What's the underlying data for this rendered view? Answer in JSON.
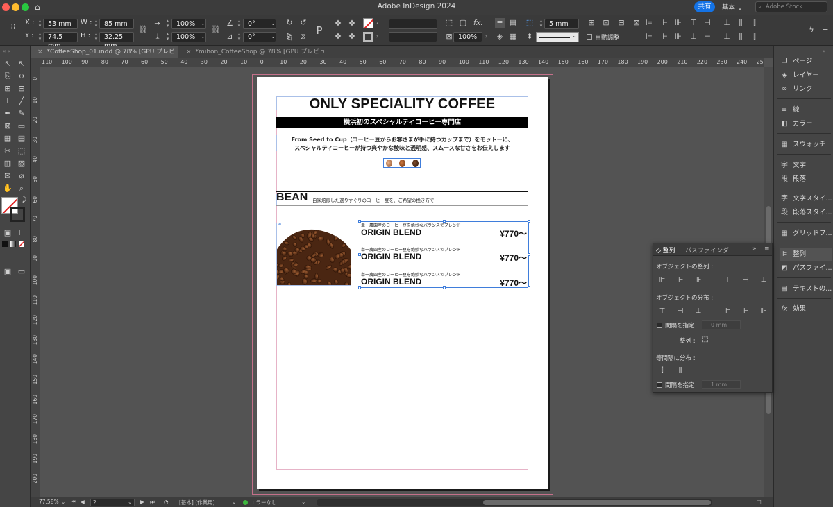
{
  "titlebar": {
    "app_title": "Adobe InDesign 2024",
    "share": "共有",
    "workspace": "基本",
    "stock_placeholder": "Adobe Stock"
  },
  "controlbar": {
    "x_label": "X :",
    "x_value": "53 mm",
    "y_label": "Y :",
    "y_value": "74.5 mm",
    "w_label": "W :",
    "w_value": "85 mm",
    "h_label": "H :",
    "h_value": "32.25 mm",
    "scale_x": "100%",
    "scale_y": "100%",
    "rotate": "0°",
    "shear": "0°",
    "stroke_weight": "5 mm",
    "opacity": "100%",
    "auto_fit": "自動調整"
  },
  "tabs": [
    {
      "label": "*CoffeeShop_01.indd @ 78% [GPU プレビュー]",
      "close": "×"
    },
    {
      "label": "*mihon_CoffeeShop @ 78% [GPU プレビュー]",
      "close": "×"
    }
  ],
  "hruler": [
    "110",
    "100",
    "90",
    "80",
    "70",
    "60",
    "50",
    "40",
    "30",
    "20",
    "10",
    "0",
    "10",
    "20",
    "30",
    "40",
    "50",
    "60",
    "70",
    "80",
    "90",
    "100",
    "110",
    "120",
    "130",
    "140",
    "150",
    "160",
    "170",
    "180",
    "190",
    "200",
    "210",
    "220",
    "230",
    "240",
    "250"
  ],
  "vruler": [
    "0",
    "10",
    "20",
    "30",
    "40",
    "50",
    "60",
    "70",
    "80",
    "90",
    "100",
    "110",
    "120",
    "130",
    "140",
    "150",
    "160",
    "170",
    "180",
    "190",
    "200"
  ],
  "document": {
    "title": "ONLY SPECIALITY COFFEE",
    "banner": "横浜初のスペシャルティコーヒー専門店",
    "desc_line1": "From Seed to Cup（コーヒー豆からお客さまが手に持つカップまで）をモットーに、",
    "desc_line2": "スペシャルティコーヒーが持つ爽やかな酸味と透明感、スムースな甘さをお伝えします",
    "bean_heading": "BEAN",
    "bean_sub": "自家焙煎した選りすぐりのコーヒー豆を、ご希望の挽き方で",
    "menu": [
      {
        "desc": "単一農園産のコーヒー豆を絶妙なバランスでブレンド",
        "name": "ORIGIN BLEND",
        "price": "¥770〜"
      },
      {
        "desc": "単一農園産のコーヒー豆を絶妙なバランスでブレンド",
        "name": "ORIGIN BLEND",
        "price": "¥770〜"
      },
      {
        "desc": "単一農園産のコーヒー豆を絶妙なバランスでブレンド",
        "name": "ORIGIN BLEND",
        "price": "¥770〜"
      }
    ]
  },
  "rightpanel": {
    "items": [
      "ページ",
      "レイヤー",
      "リンク",
      "線",
      "カラー",
      "スウォッチ",
      "文字",
      "段落",
      "文字スタイ...",
      "段落スタイ...",
      "グリッドフ...",
      "整列",
      "パスファイ...",
      "テキストの...",
      "効果"
    ]
  },
  "align_panel": {
    "tab_align": "整列",
    "tab_pathfinder": "パスファインダー",
    "align_objects": "オブジェクトの整列 :",
    "distribute_objects": "オブジェクトの分布 :",
    "use_spacing": "間隔を指定",
    "spacing1": "0 mm",
    "align_to": "整列 :",
    "distribute_spacing": "等間隔に分布 :",
    "use_spacing2": "間隔を指定",
    "spacing2": "1 mm"
  },
  "statusbar": {
    "zoom": "77.58%",
    "page": "2",
    "master": "[基本] (作業用)",
    "errors": "エラーなし"
  },
  "colors": {
    "accent": "#1473e6",
    "selection": "#3f7ddb",
    "error_ok": "#3fb83f"
  }
}
